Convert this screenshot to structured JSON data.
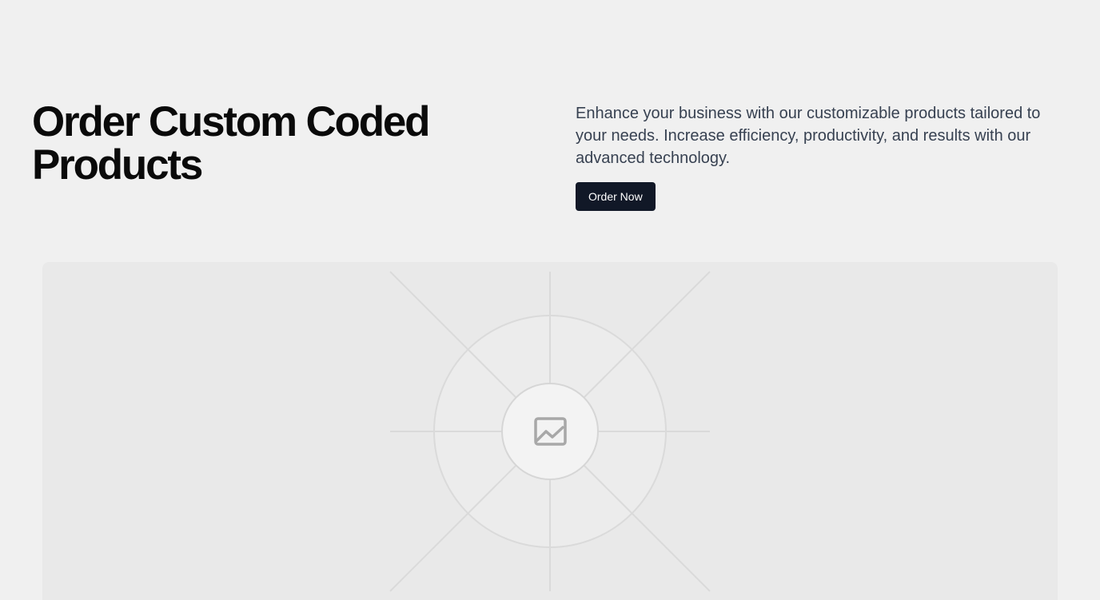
{
  "hero": {
    "title": "Order Custom Coded Products",
    "description": "Enhance your business with our customizable products tailored to your needs. Increase efficiency, productivity, and results with our advanced technology.",
    "cta_label": "Order Now"
  },
  "media": {
    "icon": "image-placeholder-icon"
  },
  "colors": {
    "background": "#f0f0f0",
    "heading": "#0a0a0a",
    "body_text": "#374151",
    "button_bg": "#111827",
    "button_text": "#ffffff",
    "placeholder_bg": "#e9e9e9"
  }
}
